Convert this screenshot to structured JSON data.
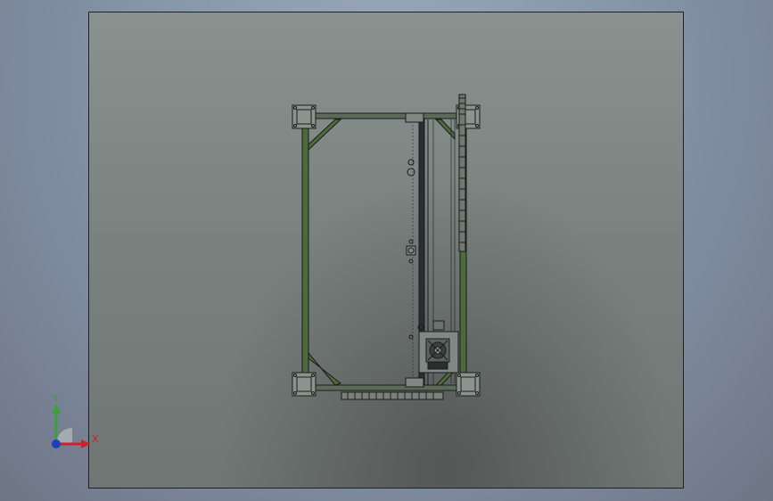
{
  "triad": {
    "x_label": "X",
    "y_label": "Y",
    "x_color": "#c8232c",
    "y_color": "#3aa13a",
    "z_color": "#1f3fbf"
  },
  "colors": {
    "frame_green": "#4d6a3c",
    "line_dark": "#1a1c1c",
    "sheet_border": "#1f2226"
  }
}
